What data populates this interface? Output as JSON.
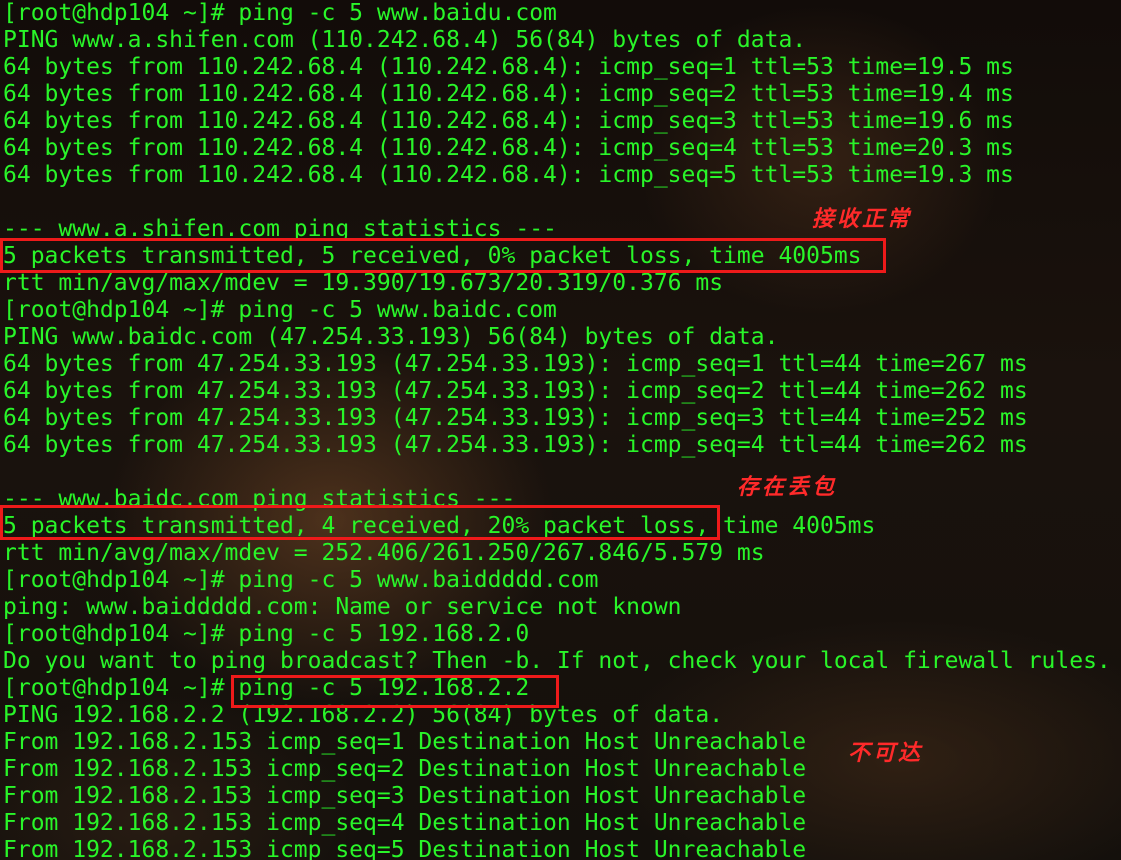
{
  "terminal": {
    "lines": [
      "[root@hdp104 ~]# ping -c 5 www.baidu.com",
      "PING www.a.shifen.com (110.242.68.4) 56(84) bytes of data.",
      "64 bytes from 110.242.68.4 (110.242.68.4): icmp_seq=1 ttl=53 time=19.5 ms",
      "64 bytes from 110.242.68.4 (110.242.68.4): icmp_seq=2 ttl=53 time=19.4 ms",
      "64 bytes from 110.242.68.4 (110.242.68.4): icmp_seq=3 ttl=53 time=19.6 ms",
      "64 bytes from 110.242.68.4 (110.242.68.4): icmp_seq=4 ttl=53 time=20.3 ms",
      "64 bytes from 110.242.68.4 (110.242.68.4): icmp_seq=5 ttl=53 time=19.3 ms",
      "",
      "--- www.a.shifen.com ping statistics ---",
      "5 packets transmitted, 5 received, 0% packet loss, time 4005ms",
      "rtt min/avg/max/mdev = 19.390/19.673/20.319/0.376 ms",
      "[root@hdp104 ~]# ping -c 5 www.baidc.com",
      "PING www.baidc.com (47.254.33.193) 56(84) bytes of data.",
      "64 bytes from 47.254.33.193 (47.254.33.193): icmp_seq=1 ttl=44 time=267 ms",
      "64 bytes from 47.254.33.193 (47.254.33.193): icmp_seq=2 ttl=44 time=262 ms",
      "64 bytes from 47.254.33.193 (47.254.33.193): icmp_seq=3 ttl=44 time=252 ms",
      "64 bytes from 47.254.33.193 (47.254.33.193): icmp_seq=4 ttl=44 time=262 ms",
      "",
      "--- www.baidc.com ping statistics ---",
      "5 packets transmitted, 4 received, 20% packet loss, time 4005ms",
      "rtt min/avg/max/mdev = 252.406/261.250/267.846/5.579 ms",
      "[root@hdp104 ~]# ping -c 5 www.baiddddd.com",
      "ping: www.baiddddd.com: Name or service not known",
      "[root@hdp104 ~]# ping -c 5 192.168.2.0",
      "Do you want to ping broadcast? Then -b. If not, check your local firewall rules.",
      "[root@hdp104 ~]# ping -c 5 192.168.2.2",
      "PING 192.168.2.2 (192.168.2.2) 56(84) bytes of data.",
      "From 192.168.2.153 icmp_seq=1 Destination Host Unreachable",
      "From 192.168.2.153 icmp_seq=2 Destination Host Unreachable",
      "From 192.168.2.153 icmp_seq=3 Destination Host Unreachable",
      "From 192.168.2.153 icmp_seq=4 Destination Host Unreachable",
      "From 192.168.2.153 icmp_seq=5 Destination Host Unreachable"
    ]
  },
  "annotations": {
    "note_received_ok": "接收正常",
    "note_packet_loss": "存在丢包",
    "note_unreachable": "不可达"
  },
  "colors": {
    "terminal_text": "#29f529",
    "annotation_red": "#ee1a1a",
    "background": "#120c09"
  }
}
